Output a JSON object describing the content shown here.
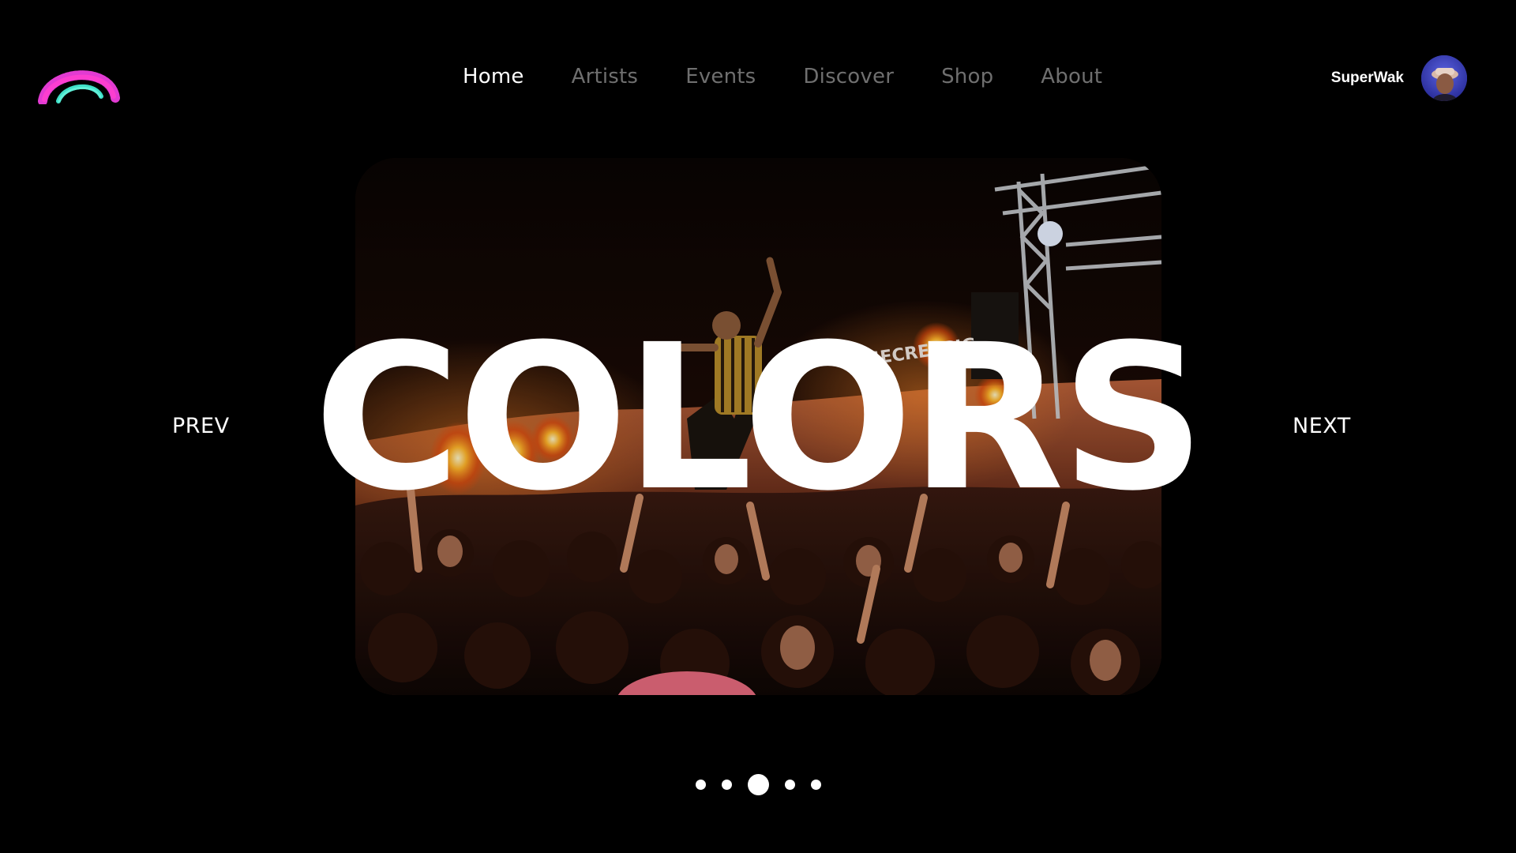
{
  "brand": {
    "logo_icon": "rainbow-arc-logo-icon",
    "colors": [
      "#e23bd2",
      "#3fe0c8"
    ]
  },
  "nav": {
    "items": [
      {
        "label": "Home",
        "active": true
      },
      {
        "label": "Artists",
        "active": false
      },
      {
        "label": "Events",
        "active": false
      },
      {
        "label": "Discover",
        "active": false
      },
      {
        "label": "Shop",
        "active": false
      },
      {
        "label": "About",
        "active": false
      }
    ]
  },
  "user": {
    "name": "SuperWak",
    "avatar_icon": "user-avatar"
  },
  "hero": {
    "title": "COLORS",
    "prev_label": "PREV",
    "next_label": "NEXT",
    "image": "concert-crowd-photo",
    "stage_sign": "SECRETGIG"
  },
  "pager": {
    "count": 5,
    "active_index": 2
  }
}
